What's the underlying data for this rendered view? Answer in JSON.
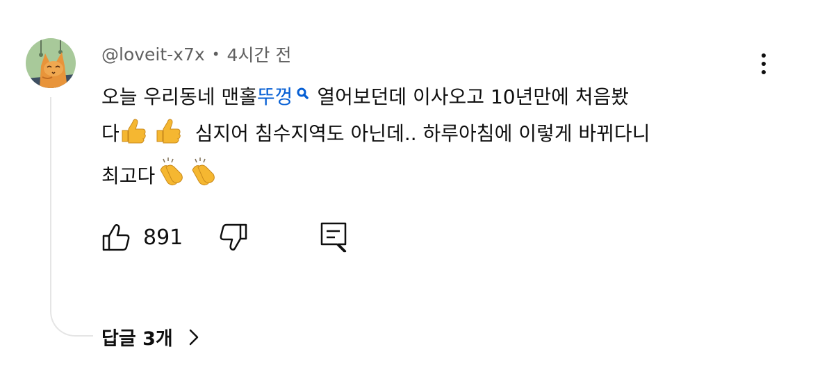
{
  "comment": {
    "author": "@loveit-x7x",
    "separator": "•",
    "time": "4시간 전",
    "text_before_link": "오늘 우리동네 맨홀",
    "link_text": "뚜껑",
    "text_after_link_line1": " 열어보던데 이사오고 10년만에 처음봤",
    "text_line2_start": "다",
    "text_line2_end": " 심지어 침수지역도 아닌데.. 하루아침에 이렇게 바뀌다니",
    "text_line3": "최고다",
    "emoji_line2": "thumbs-up-icon",
    "emoji_line3": "clapping-hands-icon"
  },
  "actions": {
    "like_count": "891",
    "like_icon": "thumbs-up-outline-icon",
    "dislike_icon": "thumbs-down-outline-icon",
    "reply_icon": "comment-reply-icon"
  },
  "replies": {
    "label": "답글 3개"
  },
  "colors": {
    "text": "#0f0f0f",
    "meta": "#606060",
    "link": "#065fd4",
    "thread": "#e5e5e5"
  }
}
